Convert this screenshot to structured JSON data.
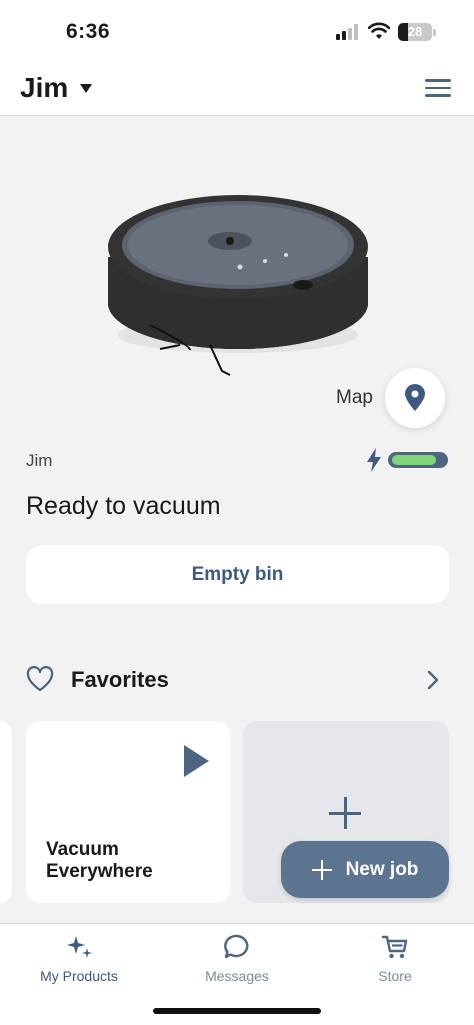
{
  "status_bar": {
    "time": "6:36",
    "battery_percent": "28",
    "battery_level": 0.28
  },
  "header": {
    "robot_name": "Jim"
  },
  "hero": {
    "map_label": "Map"
  },
  "robot": {
    "name_label": "Jim",
    "status": "Ready to vacuum",
    "battery_level": 0.85
  },
  "actions": {
    "empty_bin": "Empty bin"
  },
  "favorites": {
    "title": "Favorites",
    "cards": [
      {
        "label": "Vacuum Everywhere"
      }
    ],
    "new_job_label": "New job"
  },
  "tabs": [
    {
      "label": "My Products",
      "icon": "sparkle-icon",
      "active": true
    },
    {
      "label": "Messages",
      "icon": "chat-bubble-icon",
      "active": false
    },
    {
      "label": "Store",
      "icon": "cart-icon",
      "active": false
    }
  ],
  "colors": {
    "accent": "#3e5a82",
    "slate": "#4d6580",
    "battery_green": "#7fd67a",
    "background": "#f2f2f2"
  }
}
